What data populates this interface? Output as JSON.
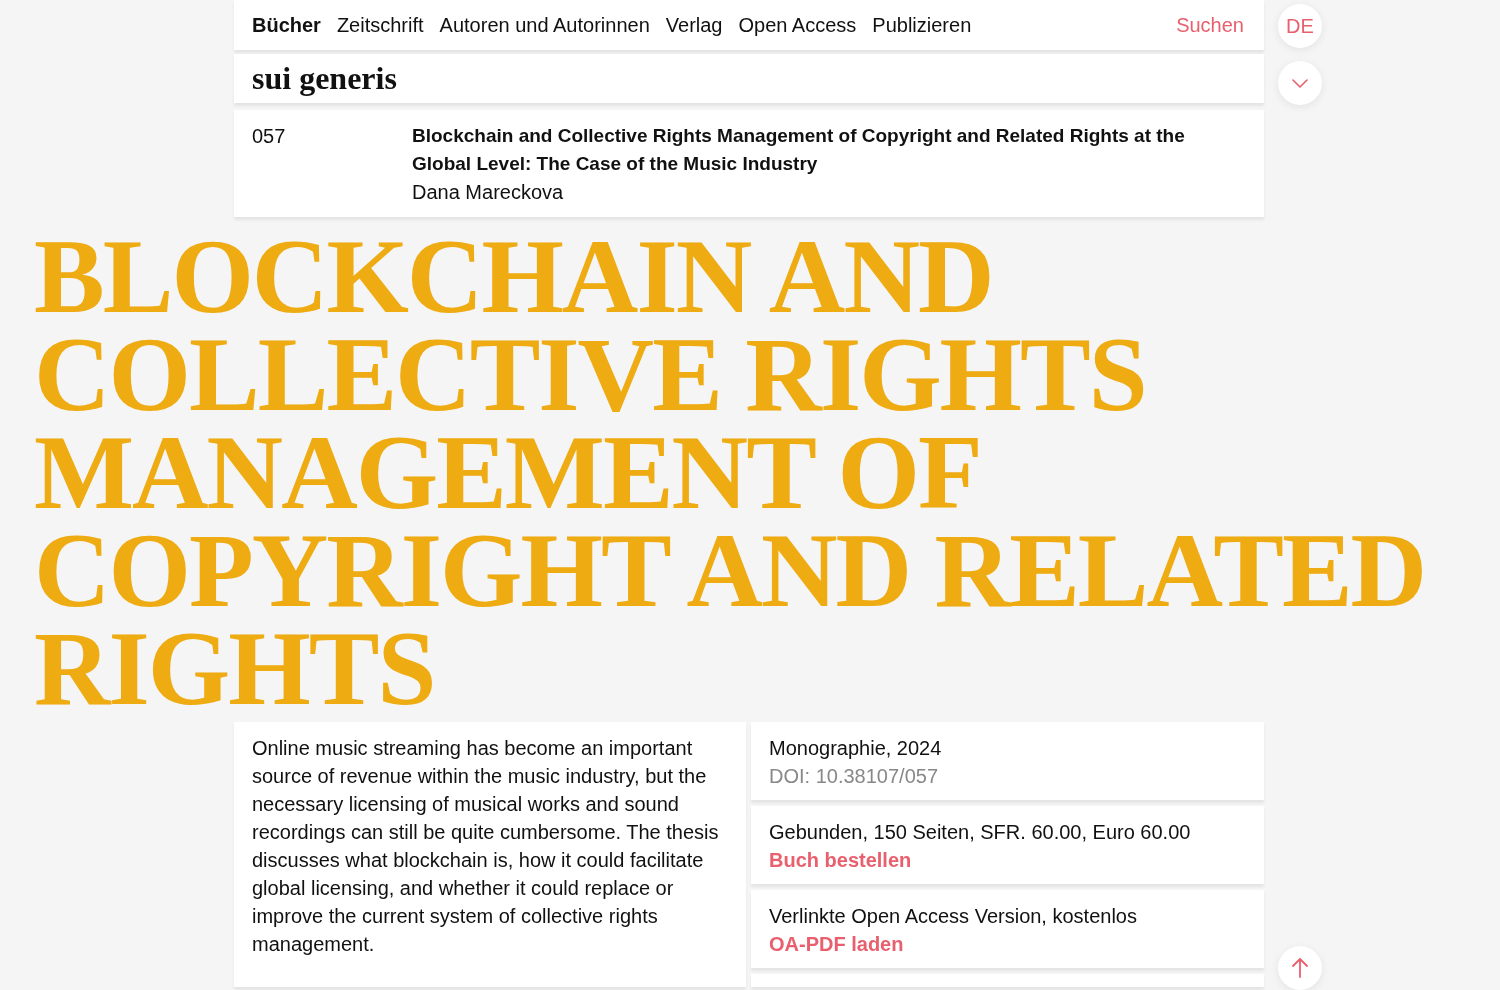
{
  "nav": {
    "items": [
      {
        "label": "Bücher",
        "selected": true
      },
      {
        "label": "Zeitschrift",
        "selected": false
      },
      {
        "label": "Autoren und Autorinnen",
        "selected": false
      },
      {
        "label": "Verlag",
        "selected": false
      },
      {
        "label": "Open Access",
        "selected": false
      },
      {
        "label": "Publizieren",
        "selected": false
      }
    ],
    "search": "Suchen"
  },
  "language": "DE",
  "series": {
    "title": "sui generis"
  },
  "book": {
    "number": "057",
    "title": "Blockchain and Collective Rights Management of Copyright and Related Rights at the Global Level: The Case of the Music Industry",
    "author": "Dana Mareckova"
  },
  "heading": "BLOCKCHAIN AND COLLECTIVE RIGHTS MANAGEMENT OF COPYRIGHT AND RELATED RIGHTS",
  "abstract": "Online music streaming has become an important source of revenue within the music industry, but the necessary licensing of musical works and sound recordings can still be quite cumbersome. The thesis discusses what blockchain is, how it could facilitate global licensing, and whether it could replace or improve the current system of collective rights management.",
  "details": [
    {
      "kind": "meta",
      "text": "Monographie, 2024",
      "secondary": "DOI: 10.38107/057"
    },
    {
      "kind": "action",
      "text": "Gebunden, 150 Seiten, SFR. 60.00, Euro 60.00",
      "link": "Buch bestellen"
    },
    {
      "kind": "action",
      "text": "Verlinkte Open Access Version, kostenlos",
      "link": "OA-PDF laden"
    }
  ]
}
